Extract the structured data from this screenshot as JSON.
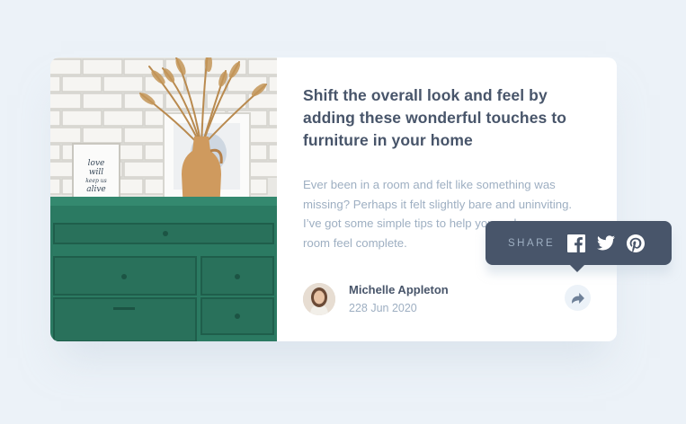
{
  "article": {
    "title": "Shift the overall look and feel by adding these wonderful touches to furniture in your home",
    "description": "Ever been in a room and felt like something was missing? Perhaps it felt slightly bare and uninviting. I’ve got some simple tips to help you make any room feel complete.",
    "image_alt": "Green drawers with dried plant in vase"
  },
  "author": {
    "name": "Michelle Appleton",
    "date": "228 Jun 2020"
  },
  "share": {
    "label": "SHARE",
    "icons": [
      "facebook-icon",
      "twitter-icon",
      "pinterest-icon"
    ]
  },
  "colors": {
    "background": "#ecf2f8",
    "card": "#ffffff",
    "heading": "#48556a",
    "muted": "#9eafc2",
    "tooltip": "#48556a",
    "share_button": "#ecf2f8"
  }
}
